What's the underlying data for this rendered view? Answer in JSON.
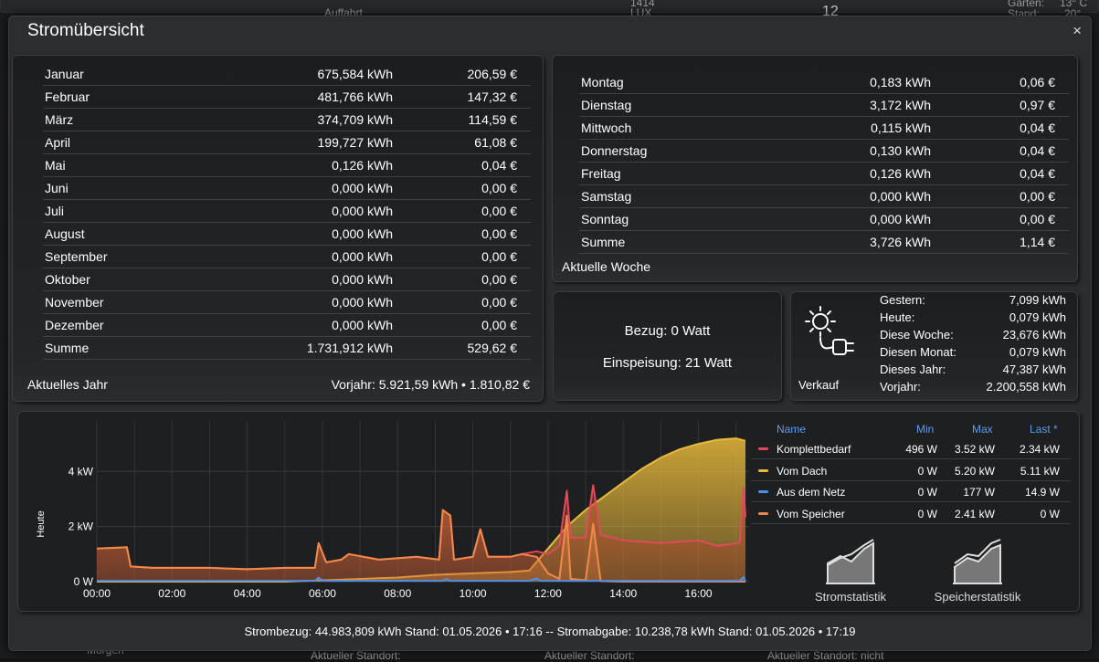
{
  "dialog": {
    "title": "Stromübersicht",
    "close_label": "×"
  },
  "background": {
    "top_labels": [
      "Auffahrt",
      "1414",
      "LUX",
      "12",
      "Garten:",
      "13° C",
      "Stand:",
      "20°"
    ],
    "bottom_labels": [
      "Morgen",
      "Aktueller Standort:",
      "Aktueller Standort:",
      "Aktueller Standort: nicht"
    ]
  },
  "year": {
    "rows": [
      {
        "label": "Januar",
        "kwh": "675,584 kWh",
        "eur": "206,59 €"
      },
      {
        "label": "Februar",
        "kwh": "481,766 kWh",
        "eur": "147,32 €"
      },
      {
        "label": "März",
        "kwh": "374,709 kWh",
        "eur": "114,59 €"
      },
      {
        "label": "April",
        "kwh": "199,727 kWh",
        "eur": "61,08 €"
      },
      {
        "label": "Mai",
        "kwh": "0,126 kWh",
        "eur": "0,04 €"
      },
      {
        "label": "Juni",
        "kwh": "0,000 kWh",
        "eur": "0,00 €"
      },
      {
        "label": "Juli",
        "kwh": "0,000 kWh",
        "eur": "0,00 €"
      },
      {
        "label": "August",
        "kwh": "0,000 kWh",
        "eur": "0,00 €"
      },
      {
        "label": "September",
        "kwh": "0,000 kWh",
        "eur": "0,00 €"
      },
      {
        "label": "Oktober",
        "kwh": "0,000 kWh",
        "eur": "0,00 €"
      },
      {
        "label": "November",
        "kwh": "0,000 kWh",
        "eur": "0,00 €"
      },
      {
        "label": "Dezember",
        "kwh": "0,000 kWh",
        "eur": "0,00 €"
      },
      {
        "label": "Summe",
        "kwh": "1.731,912 kWh",
        "eur": "529,62 €"
      }
    ],
    "footer_left": "Aktuelles Jahr",
    "footer_right": "Vorjahr: 5.921,59 kWh • 1.810,82 €"
  },
  "week": {
    "rows": [
      {
        "label": "Montag",
        "kwh": "0,183 kWh",
        "eur": "0,06 €"
      },
      {
        "label": "Dienstag",
        "kwh": "3,172 kWh",
        "eur": "0,97 €"
      },
      {
        "label": "Mittwoch",
        "kwh": "0,115 kWh",
        "eur": "0,04 €"
      },
      {
        "label": "Donnerstag",
        "kwh": "0,130 kWh",
        "eur": "0,04 €"
      },
      {
        "label": "Freitag",
        "kwh": "0,126 kWh",
        "eur": "0,04 €"
      },
      {
        "label": "Samstag",
        "kwh": "0,000 kWh",
        "eur": "0,00 €"
      },
      {
        "label": "Sonntag",
        "kwh": "0,000 kWh",
        "eur": "0,00 €"
      },
      {
        "label": "Summe",
        "kwh": "3,726 kWh",
        "eur": "1,14 €"
      }
    ],
    "footer_left": "Aktuelle Woche"
  },
  "power": {
    "bezug": "Bezug: 0 Watt",
    "einspeisung": "Einspeisung: 21 Watt"
  },
  "verkauf": {
    "label": "Verkauf",
    "icon": "solar-plug-icon",
    "rows": [
      {
        "label": "Gestern:",
        "value": "7,099 kWh"
      },
      {
        "label": "Heute:",
        "value": "0,079 kWh"
      },
      {
        "label": "Diese Woche:",
        "value": "23,676 kWh"
      },
      {
        "label": "Diesen Monat:",
        "value": "0,079 kWh"
      },
      {
        "label": "Dieses Jahr:",
        "value": "47,387 kWh"
      },
      {
        "label": "Vorjahr:",
        "value": "2.200,558 kWh"
      }
    ]
  },
  "legend": {
    "headers": {
      "name": "Name",
      "min": "Min",
      "max": "Max",
      "last": "Last *"
    },
    "rows": [
      {
        "name": "Komplettbedarf",
        "min": "496 W",
        "max": "3.52 kW",
        "last": "2.34 kW",
        "color": "#e24a5c"
      },
      {
        "name": "Vom Dach",
        "min": "0 W",
        "max": "5.20 kW",
        "last": "5.11 kW",
        "color": "#e8b93a"
      },
      {
        "name": "Aus dem Netz",
        "min": "0 W",
        "max": "177 W",
        "last": "14.9 W",
        "color": "#4f8fe6"
      },
      {
        "name": "Vom Speicher",
        "min": "0 W",
        "max": "2.41 kW",
        "last": "0 W",
        "color": "#f08a4b"
      }
    ],
    "buttons": [
      {
        "label": "Stromstatistik",
        "icon": "area-chart-icon"
      },
      {
        "label": "Speicherstatistik",
        "icon": "area-chart-icon"
      }
    ]
  },
  "chart_data": {
    "type": "area",
    "ylabel": "Heute",
    "xlabel": "",
    "x_unit": "hour of day",
    "x_ticks": [
      "00:00",
      "02:00",
      "04:00",
      "06:00",
      "08:00",
      "10:00",
      "12:00",
      "14:00",
      "16:00"
    ],
    "y_ticks": [
      "0 W",
      "2 kW",
      "4 kW"
    ],
    "ylim": [
      0,
      5.5
    ],
    "xlim": [
      0,
      17.25
    ],
    "grid": true,
    "series": [
      {
        "name": "Vom Dach",
        "color": "#e8b93a",
        "points": [
          [
            0,
            0
          ],
          [
            5,
            0
          ],
          [
            6,
            0.05
          ],
          [
            7,
            0.1
          ],
          [
            8,
            0.15
          ],
          [
            9,
            0.25
          ],
          [
            10,
            0.3
          ],
          [
            11,
            0.35
          ],
          [
            11.5,
            0.4
          ],
          [
            12,
            1.2
          ],
          [
            12.5,
            2.0
          ],
          [
            13,
            2.6
          ],
          [
            13.5,
            3.1
          ],
          [
            14,
            3.6
          ],
          [
            14.5,
            4.1
          ],
          [
            15,
            4.5
          ],
          [
            15.5,
            4.8
          ],
          [
            16,
            5.0
          ],
          [
            16.5,
            5.15
          ],
          [
            17,
            5.2
          ],
          [
            17.25,
            5.11
          ]
        ]
      },
      {
        "name": "Komplettbedarf",
        "color": "#e24a5c",
        "points": [
          [
            0,
            1.2
          ],
          [
            0.8,
            1.25
          ],
          [
            0.9,
            0.55
          ],
          [
            1.5,
            0.5
          ],
          [
            3,
            0.5
          ],
          [
            4,
            0.45
          ],
          [
            5,
            0.5
          ],
          [
            5.8,
            0.5
          ],
          [
            5.9,
            1.4
          ],
          [
            6.1,
            0.7
          ],
          [
            6.5,
            0.8
          ],
          [
            6.7,
            1.0
          ],
          [
            7.5,
            0.8
          ],
          [
            8.5,
            0.9
          ],
          [
            9.1,
            0.8
          ],
          [
            9.2,
            2.6
          ],
          [
            9.4,
            2.4
          ],
          [
            9.5,
            0.8
          ],
          [
            10,
            0.9
          ],
          [
            10.2,
            1.9
          ],
          [
            10.4,
            0.9
          ],
          [
            11,
            0.9
          ],
          [
            11.3,
            1.0
          ],
          [
            11.7,
            1.1
          ],
          [
            12,
            1.0
          ],
          [
            12.3,
            1.3
          ],
          [
            12.5,
            3.3
          ],
          [
            12.6,
            1.6
          ],
          [
            13,
            1.6
          ],
          [
            13.2,
            3.5
          ],
          [
            13.4,
            1.7
          ],
          [
            14,
            1.5
          ],
          [
            15,
            1.4
          ],
          [
            16,
            1.5
          ],
          [
            16.5,
            1.3
          ],
          [
            17.1,
            1.4
          ],
          [
            17.2,
            3.4
          ],
          [
            17.25,
            2.34
          ]
        ]
      },
      {
        "name": "Vom Speicher",
        "color": "#f08a4b",
        "points": [
          [
            0,
            1.2
          ],
          [
            0.8,
            1.25
          ],
          [
            0.9,
            0.55
          ],
          [
            1.5,
            0.5
          ],
          [
            3,
            0.5
          ],
          [
            4,
            0.45
          ],
          [
            5,
            0.5
          ],
          [
            5.8,
            0.5
          ],
          [
            5.9,
            1.4
          ],
          [
            6.1,
            0.7
          ],
          [
            6.5,
            0.8
          ],
          [
            6.7,
            1.0
          ],
          [
            7.5,
            0.8
          ],
          [
            8.5,
            0.9
          ],
          [
            9.1,
            0.8
          ],
          [
            9.2,
            2.6
          ],
          [
            9.4,
            2.4
          ],
          [
            9.5,
            0.8
          ],
          [
            10,
            0.9
          ],
          [
            10.2,
            1.9
          ],
          [
            10.4,
            0.9
          ],
          [
            11,
            0.9
          ],
          [
            11.3,
            1.0
          ],
          [
            11.7,
            0.9
          ],
          [
            12,
            0.3
          ],
          [
            12.3,
            0.1
          ],
          [
            12.5,
            2.4
          ],
          [
            12.6,
            0.1
          ],
          [
            13,
            0.05
          ],
          [
            13.2,
            2.1
          ],
          [
            13.4,
            0.02
          ],
          [
            14,
            0
          ],
          [
            17.25,
            0
          ]
        ]
      },
      {
        "name": "Aus dem Netz",
        "color": "#4f8fe6",
        "points": [
          [
            0,
            0.03
          ],
          [
            5.8,
            0.03
          ],
          [
            5.9,
            0.15
          ],
          [
            6,
            0.03
          ],
          [
            9.2,
            0.03
          ],
          [
            9.3,
            0.1
          ],
          [
            9.4,
            0.03
          ],
          [
            11.5,
            0.03
          ],
          [
            11.7,
            0.12
          ],
          [
            11.8,
            0.03
          ],
          [
            17.1,
            0.03
          ],
          [
            17.2,
            0.17
          ],
          [
            17.25,
            0.015
          ]
        ]
      }
    ]
  },
  "footer": {
    "text": "Strombezug: 44.983,809 kWh Stand: 01.05.2026 • 17:16 -- Stromabgabe: 10.238,78 kWh Stand: 01.05.2026 • 17:19"
  }
}
